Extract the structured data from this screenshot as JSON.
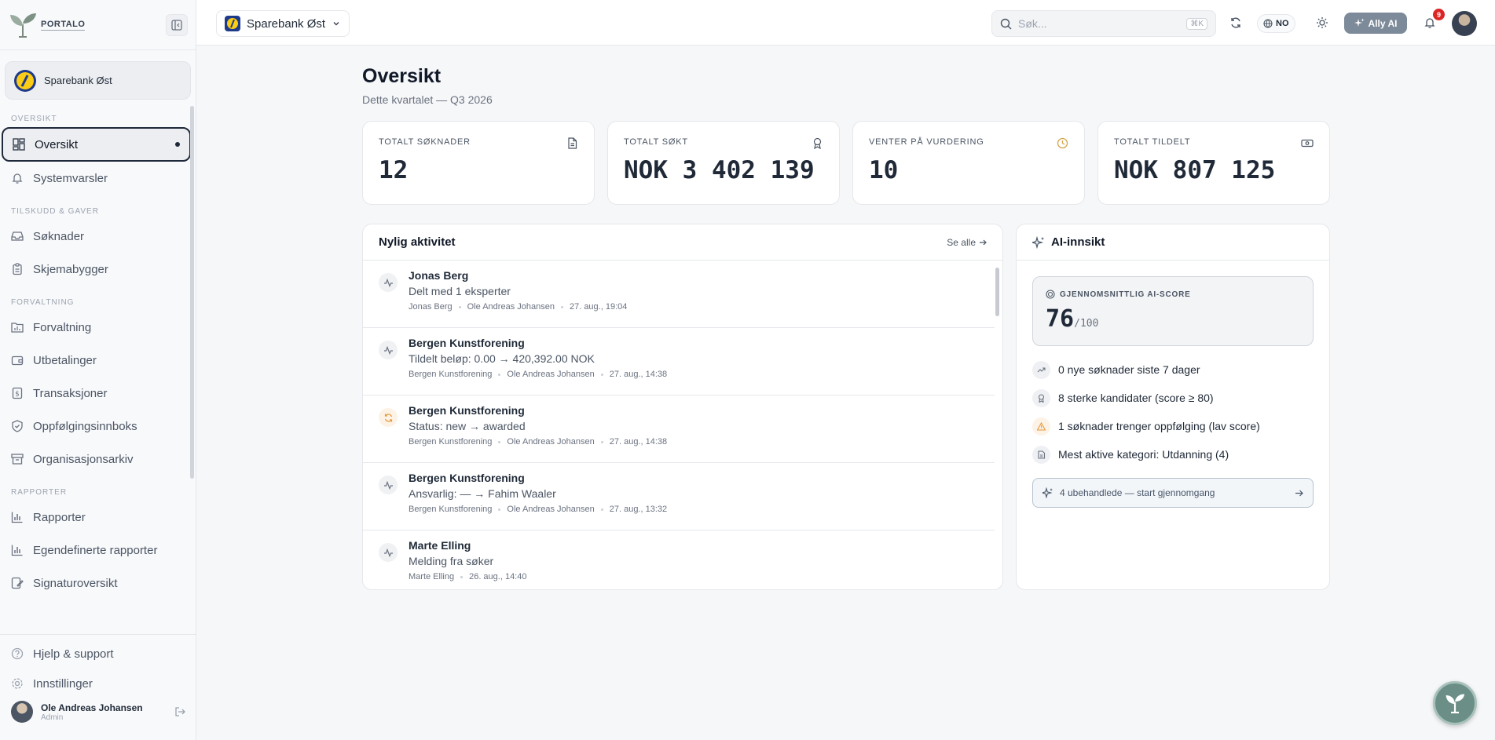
{
  "app": {
    "logo_text": "PORTALO"
  },
  "sidebar": {
    "org_name": "Sparebank Øst",
    "sections": [
      {
        "label": "OVERSIKT",
        "items": [
          {
            "label": "Oversikt",
            "icon": "dashboard-icon",
            "active": true
          },
          {
            "label": "Systemvarsler",
            "icon": "bell-icon"
          }
        ]
      },
      {
        "label": "TILSKUDD & GAVER",
        "items": [
          {
            "label": "Søknader",
            "icon": "inbox-icon"
          },
          {
            "label": "Skjemabygger",
            "icon": "clipboard-icon"
          }
        ]
      },
      {
        "label": "FORVALTNING",
        "items": [
          {
            "label": "Forvaltning",
            "icon": "folder-chart-icon"
          },
          {
            "label": "Utbetalinger",
            "icon": "wallet-icon"
          },
          {
            "label": "Transaksjoner",
            "icon": "receipt-icon"
          },
          {
            "label": "Oppfølgingsinnboks",
            "icon": "shield-check-icon"
          },
          {
            "label": "Organisasjonsarkiv",
            "icon": "archive-icon"
          }
        ]
      },
      {
        "label": "RAPPORTER",
        "items": [
          {
            "label": "Rapporter",
            "icon": "bar-chart-icon"
          },
          {
            "label": "Egendefinerte rapporter",
            "icon": "bar-chart-icon"
          },
          {
            "label": "Signaturoversikt",
            "icon": "signature-icon"
          }
        ]
      }
    ],
    "help": "Hjelp & support",
    "settings": "Innstillinger",
    "user": {
      "name": "Ole Andreas Johansen",
      "role": "Admin"
    }
  },
  "header": {
    "org_switch": "Sparebank Øst",
    "search_placeholder": "Søk...",
    "search_shortcut": "⌘K",
    "lang": "NO",
    "ally_label": "Ally AI",
    "notif_count": "9"
  },
  "page": {
    "title": "Oversikt",
    "subtitle": "Dette kvartalet — Q3 2026"
  },
  "stats": [
    {
      "label": "TOTALT SØKNADER",
      "value": "12",
      "icon": "document-icon"
    },
    {
      "label": "TOTALT SØKT",
      "value": "NOK 3 402 139",
      "icon": "award-icon"
    },
    {
      "label": "VENTER PÅ VURDERING",
      "value": "10",
      "icon": "clock-icon",
      "icon_color": "#d4a44c"
    },
    {
      "label": "TOTALT TILDELT",
      "value": "NOK 807 125",
      "icon": "banknote-icon"
    }
  ],
  "activity": {
    "title": "Nylig aktivitet",
    "see_all": "Se alle",
    "rows": [
      {
        "icon": "activity-icon",
        "name": "Jonas Berg",
        "desc": "Delt med 1 eksperter",
        "meta": [
          "Jonas Berg",
          "Ole Andreas Johansen",
          "27. aug., 19:04"
        ]
      },
      {
        "icon": "activity-icon",
        "name": "Bergen Kunstforening",
        "desc": "Tildelt beløp: 0.00 → 420,392.00 NOK",
        "meta": [
          "Bergen Kunstforening",
          "Ole Andreas Johansen",
          "27. aug., 14:38"
        ]
      },
      {
        "icon": "refresh-icon",
        "name": "Bergen Kunstforening",
        "desc": "Status: new → awarded",
        "meta": [
          "Bergen Kunstforening",
          "Ole Andreas Johansen",
          "27. aug., 14:38"
        ]
      },
      {
        "icon": "activity-icon",
        "name": "Bergen Kunstforening",
        "desc": "Ansvarlig: — → Fahim Waaler",
        "meta": [
          "Bergen Kunstforening",
          "Ole Andreas Johansen",
          "27. aug., 13:32"
        ]
      },
      {
        "icon": "activity-icon",
        "name": "Marte Elling",
        "desc": "Melding fra søker",
        "meta": [
          "Marte Elling",
          "26. aug., 14:40"
        ]
      }
    ]
  },
  "ai": {
    "title": "AI-innsikt",
    "score_label": "GJENNOMSNITTLIG AI-SCORE",
    "score": "76",
    "score_max": "/100",
    "insights": [
      {
        "icon": "trending-up-icon",
        "text": "0 nye søknader siste 7 dager"
      },
      {
        "icon": "award-icon",
        "text": "8 sterke kandidater (score ≥ 80)"
      },
      {
        "icon": "warning-icon",
        "text": "1 søknader trenger oppfølging (lav score)"
      },
      {
        "icon": "document-icon",
        "text": "Mest aktive kategori: Utdanning (4)"
      }
    ],
    "cta": "4 ubehandlede — start gjennomgang"
  }
}
